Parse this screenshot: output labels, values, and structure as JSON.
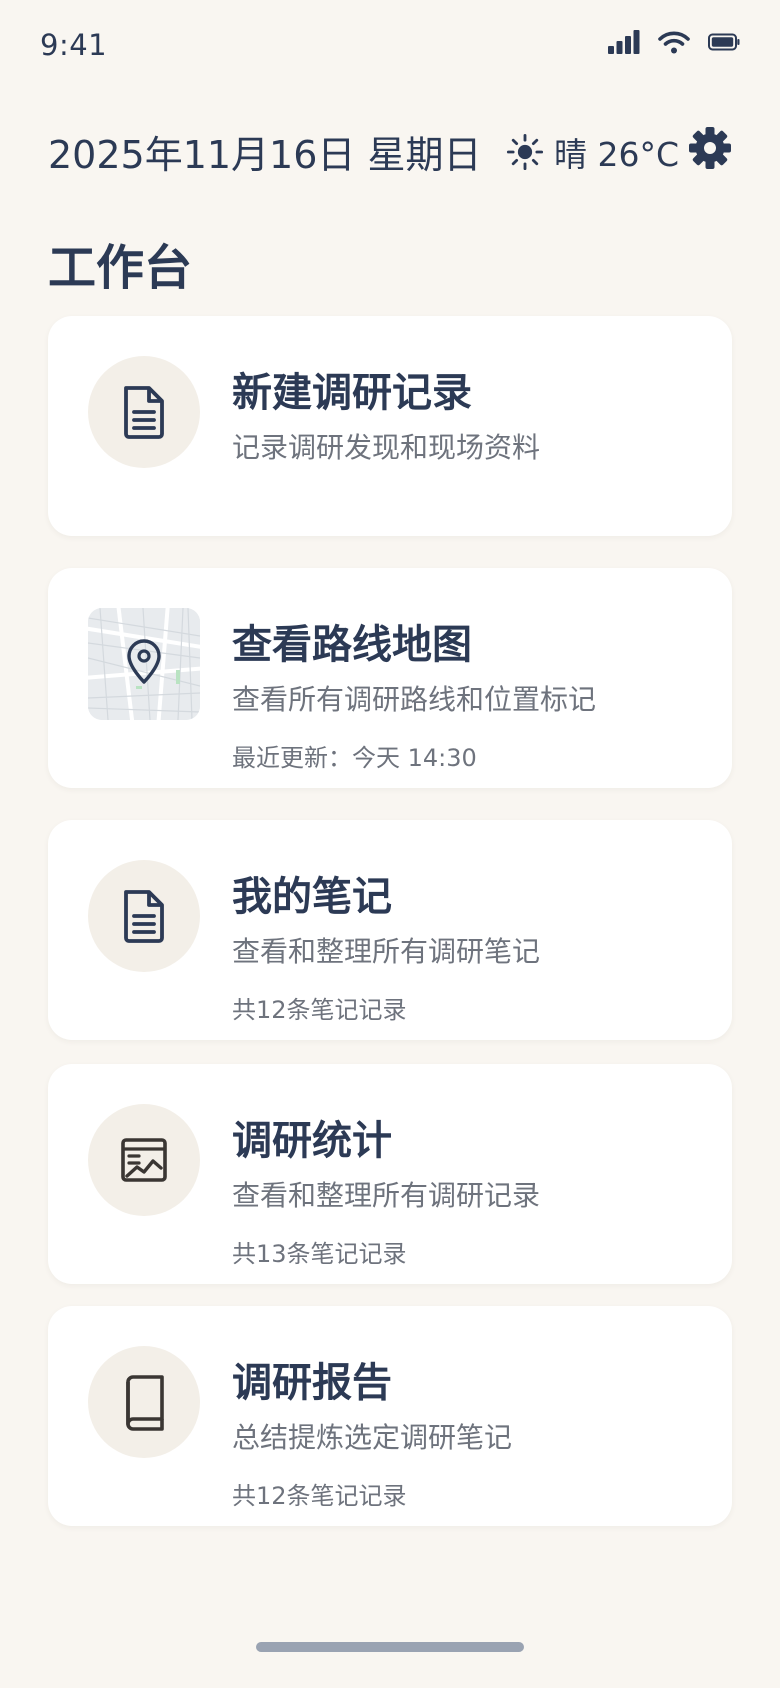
{
  "status_bar": {
    "time": "9:41"
  },
  "header": {
    "date": "2025年11月16日 星期日",
    "weather": "晴 26°C"
  },
  "page_title": "工作台",
  "cards": [
    {
      "title": "新建调研记录",
      "desc": "记录调研发现和现场资料",
      "meta": "",
      "icon": "document-icon"
    },
    {
      "title": "查看路线地图",
      "desc": "查看所有调研路线和位置标记",
      "meta": "最近更新：今天 14:30",
      "icon": "map-pin-icon"
    },
    {
      "title": "我的笔记",
      "desc": "查看和整理所有调研笔记",
      "meta": "共12条笔记记录",
      "icon": "document-icon"
    },
    {
      "title": "调研统计",
      "desc": "查看和整理所有调研记录",
      "meta": "共13条笔记记录",
      "icon": "chart-icon"
    },
    {
      "title": "调研报告",
      "desc": "总结提炼选定调研笔记",
      "meta": "共12条笔记记录",
      "icon": "book-icon"
    }
  ],
  "colors": {
    "background": "#f9f6f1",
    "primary_text": "#2c3a55",
    "secondary_text": "#6e737d",
    "icon_circle": "#f3efe8",
    "home_indicator": "#9aa3b2"
  }
}
